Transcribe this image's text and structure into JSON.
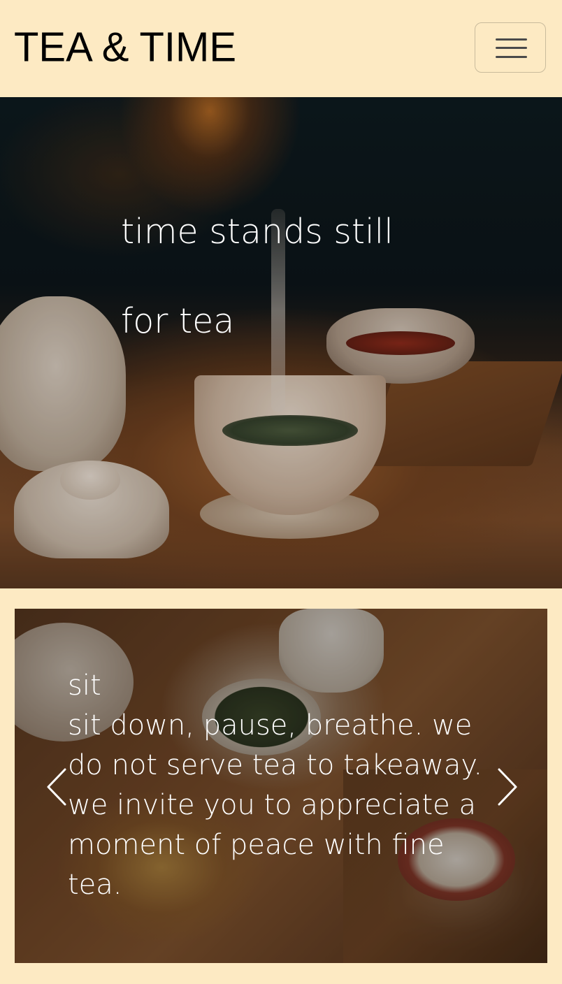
{
  "navbar": {
    "brand": "TEA & TIME",
    "toggler_icon": "hamburger-menu-icon"
  },
  "hero": {
    "line1": "time stands still",
    "line2": "for tea"
  },
  "carousel": {
    "slide_title": "sit",
    "slide_text": "sit down, pause, breathe. we do not serve tea to takeaway. we invite you to appreciate a moment of peace with fine tea.",
    "prev_icon": "chevron-left-icon",
    "next_icon": "chevron-right-icon"
  },
  "colors": {
    "background": "#fdeac3",
    "brand_text": "#000000",
    "overlay_text": "#ffffff",
    "toggler_border": "#c9bb9c",
    "toggler_icon": "#4a4a4a"
  }
}
